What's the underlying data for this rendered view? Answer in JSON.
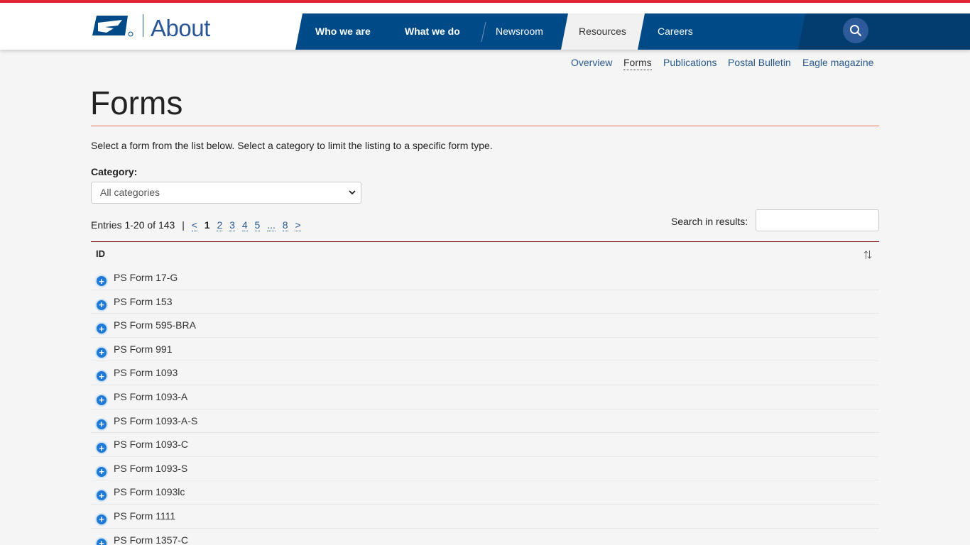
{
  "brand": {
    "title": "About"
  },
  "nav": {
    "items": [
      {
        "label": "Who we are"
      },
      {
        "label": "What we do"
      },
      {
        "label": "Newsroom"
      },
      {
        "label": "Resources"
      },
      {
        "label": "Careers"
      }
    ],
    "active": "Resources"
  },
  "subnav": {
    "items": [
      {
        "label": "Overview"
      },
      {
        "label": "Forms"
      },
      {
        "label": "Publications"
      },
      {
        "label": "Postal Bulletin"
      },
      {
        "label": "Eagle magazine"
      }
    ],
    "active": "Forms"
  },
  "page": {
    "title": "Forms",
    "intro": "Select a form from the list below. Select a category to limit the listing to a specific form type."
  },
  "category": {
    "label": "Category:",
    "selected": "All categories"
  },
  "pager": {
    "entries_text": "Entries 1-20 of 143",
    "separator": "|",
    "prev": "<",
    "pages": [
      "1",
      "2",
      "3",
      "4",
      "5",
      "...",
      "8"
    ],
    "current": "1",
    "next": ">"
  },
  "search": {
    "label": "Search in results:",
    "value": ""
  },
  "table": {
    "column_header": "ID",
    "rows": [
      "PS Form 17-G",
      "PS Form 153",
      "PS Form 595-BRA",
      "PS Form 991",
      "PS Form 1093",
      "PS Form 1093-A",
      "PS Form 1093-A-S",
      "PS Form 1093-C",
      "PS Form 1093-S",
      "PS Form 1093lc",
      "PS Form 1111",
      "PS Form 1357-C"
    ]
  },
  "colors": {
    "usps_blue": "#004b87",
    "accent_red": "#e32636",
    "link_blue": "#285a8f",
    "plus_blue": "#1f7ad6"
  }
}
